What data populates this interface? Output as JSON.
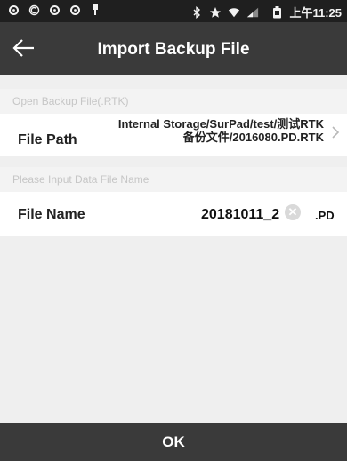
{
  "status_bar": {
    "left_icons": [
      "sync-icon",
      "c-icon",
      "sync-icon",
      "sync-icon",
      "usb-icon"
    ],
    "right_icons": [
      "bluetooth-icon",
      "star-icon",
      "wifi-icon",
      "signal-icon",
      "battery-icon"
    ],
    "time": "上午11:25"
  },
  "header": {
    "title": "Import Backup File",
    "back_icon": "arrow-left-icon"
  },
  "open_section": {
    "label": "Open Backup File(.RTK)"
  },
  "file_path": {
    "label": "File Path",
    "value": "Internal Storage/SurPad/test/测试RTK备份文件/2016080.PD.RTK"
  },
  "input_section": {
    "label": "Please Input Data File Name"
  },
  "file_name": {
    "label": "File Name",
    "value": "20181011_2",
    "extension": ".PD"
  },
  "footer": {
    "ok_label": "OK"
  },
  "colors": {
    "status_bar": "#1f1f1f",
    "app_bar": "#3a3a3a",
    "background": "#efefef",
    "section_text": "#c6c6c6"
  }
}
